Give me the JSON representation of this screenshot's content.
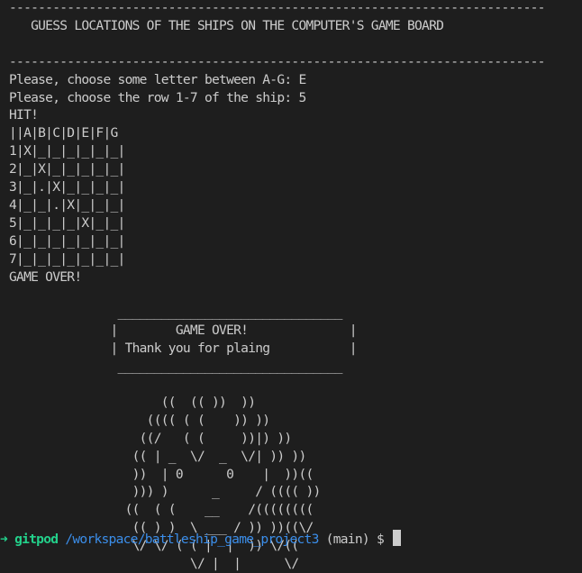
{
  "terminal": {
    "output": "--------------------------------------------------------------------------\n   GUESS LOCATIONS OF THE SHIPS ON THE COMPUTER'S GAME BOARD\n\n--------------------------------------------------------------------------\nPlease, choose some letter between A-G: E\nPlease, choose the row 1-7 of the ship: 5\nHIT!\n||A|B|C|D|E|F|G\n1|X|_|_|_|_|_|_|\n2|_|X|_|_|_|_|_|\n3|_|.|X|_|_|_|_|\n4|_|_|.|X|_|_|_|\n5|_|_|_|_|X|_|_|\n6|_|_|_|_|_|_|_|\n7|_|_|_|_|_|_|_|\nGAME OVER!\n\n               _______________________________\n              |        GAME OVER!              |\n              | Thank you for plaing           |\n               _______________________________\n\n                     ((  (( ))  ))\n                   (((( ( (    )) ))\n                  ((/   ( (     ))|) ))\n                 (( | _  \\/  _  \\/| )) ))\n                 ))  | 0      0    |  ))((\n                 ))) )      _     / (((( ))\n                ((  ( (    __    /((((((((\n                 (( ) )  \\ ___ / )) ))((\\/\n                 \\/ \\/ ( ( |  |  )) \\/((\n                         \\/ |  |      \\/"
  },
  "prompt": {
    "arrow": "➜ ",
    "user": "gitpod",
    "path": "/workspace/battleship_game_project3",
    "branch": "(main)",
    "sign": "$"
  }
}
